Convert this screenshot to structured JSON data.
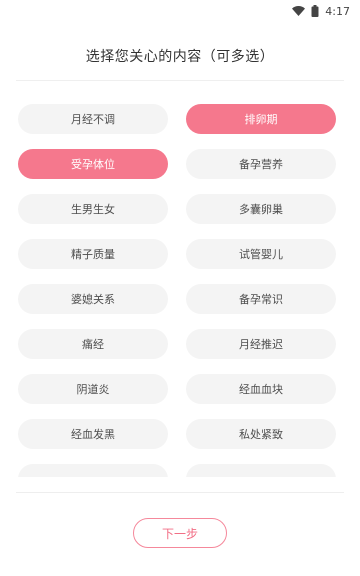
{
  "status_bar": {
    "time": "4:17",
    "icons": [
      "wifi-icon",
      "battery-icon"
    ]
  },
  "header": {
    "title": "选择您关心的内容（可多选）"
  },
  "options": [
    {
      "label": "月经不调",
      "selected": false
    },
    {
      "label": "排卵期",
      "selected": true
    },
    {
      "label": "受孕体位",
      "selected": true
    },
    {
      "label": "备孕营养",
      "selected": false
    },
    {
      "label": "生男生女",
      "selected": false
    },
    {
      "label": "多囊卵巢",
      "selected": false
    },
    {
      "label": "精子质量",
      "selected": false
    },
    {
      "label": "试管婴儿",
      "selected": false
    },
    {
      "label": "婆媳关系",
      "selected": false
    },
    {
      "label": "备孕常识",
      "selected": false
    },
    {
      "label": "痛经",
      "selected": false
    },
    {
      "label": "月经推迟",
      "selected": false
    },
    {
      "label": "阴道炎",
      "selected": false
    },
    {
      "label": "经血血块",
      "selected": false
    },
    {
      "label": "经血发黑",
      "selected": false
    },
    {
      "label": "私处紧致",
      "selected": false
    },
    {
      "label": "",
      "selected": false
    },
    {
      "label": "",
      "selected": false
    }
  ],
  "footer": {
    "next_label": "下一步"
  },
  "colors": {
    "accent": "#f5788d",
    "chip_bg": "#f4f4f4",
    "chip_text": "#4d4d4d"
  }
}
